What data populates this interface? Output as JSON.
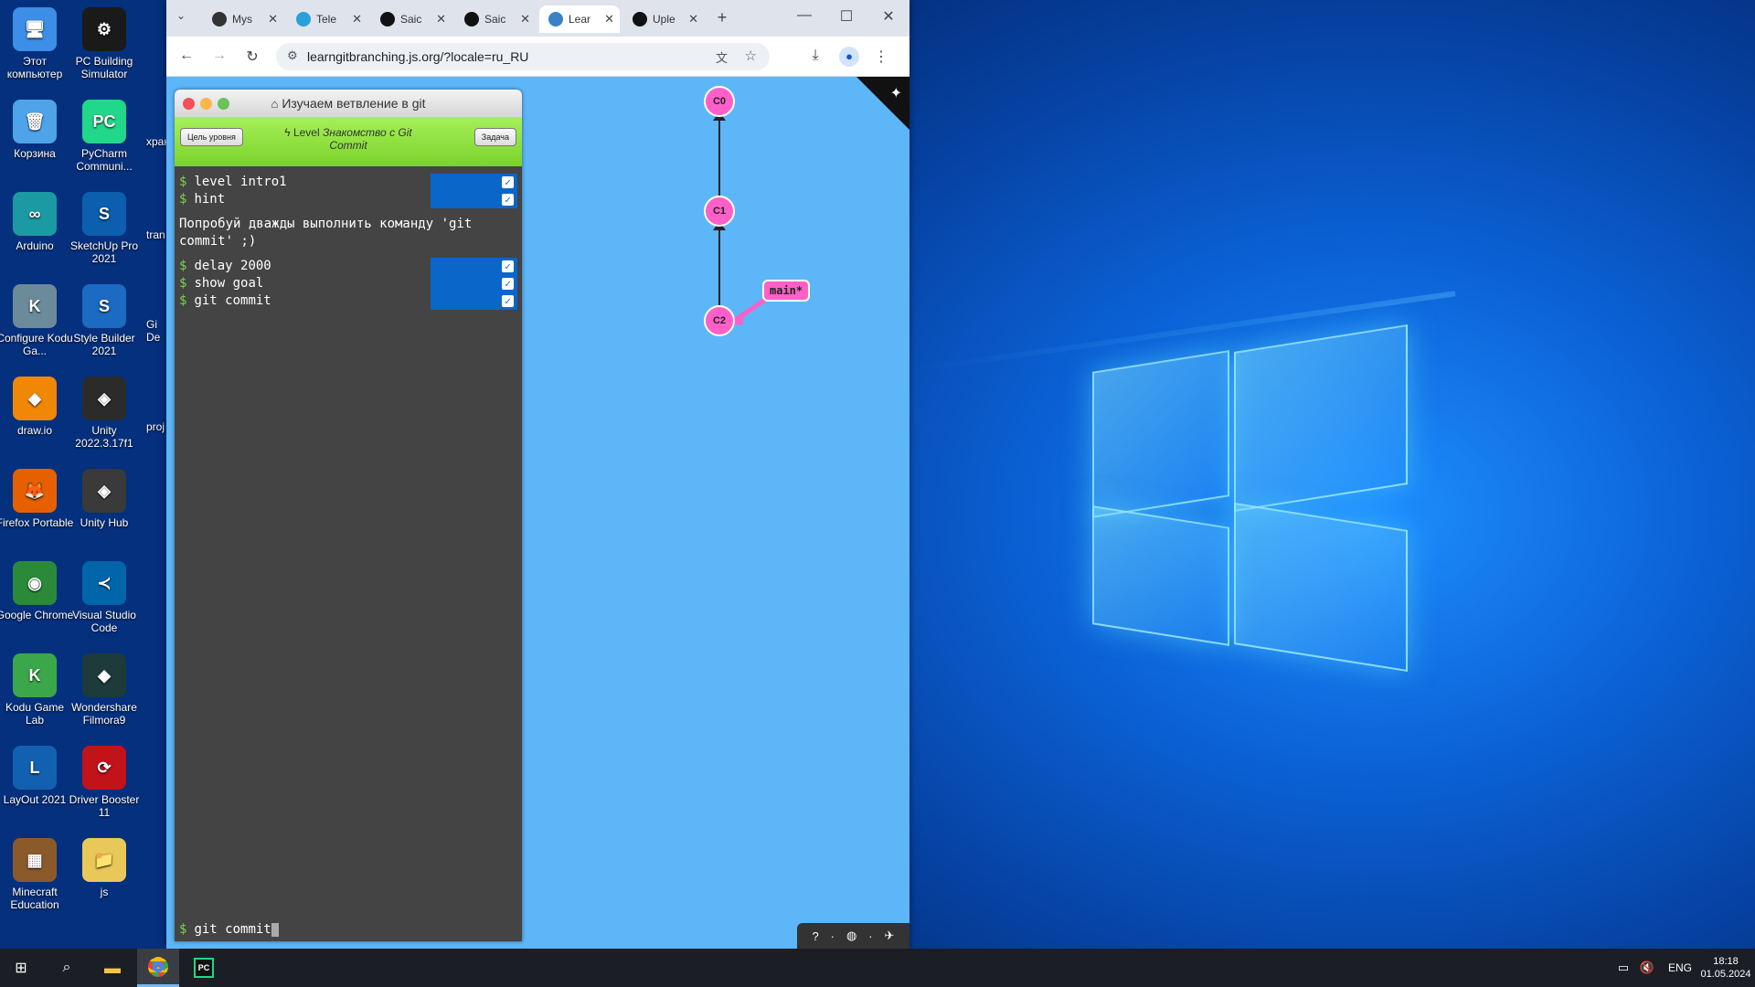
{
  "desktop": {
    "icons": [
      {
        "label": "Этот компьютер",
        "glyph": "🖥",
        "color": "#3c8ee6"
      },
      {
        "label": "PC Building Simulator",
        "glyph": "⚙",
        "color": "#1a1a1a"
      },
      {
        "label": "Корзина",
        "glyph": "🗑",
        "color": "#4fa3e8"
      },
      {
        "label": "PyCharm Communi...",
        "glyph": "PC",
        "color": "#21d789"
      },
      {
        "label": "Arduino",
        "glyph": "∞",
        "color": "#1c9aa4"
      },
      {
        "label": "SketchUp Pro 2021",
        "glyph": "S",
        "color": "#0b5fae"
      },
      {
        "label": "Configure Kodu Ga...",
        "glyph": "K",
        "color": "#6b8a9a"
      },
      {
        "label": "Style Builder 2021",
        "glyph": "S",
        "color": "#1b6bc2"
      },
      {
        "label": "draw.io",
        "glyph": "◆",
        "color": "#f08705"
      },
      {
        "label": "Unity 2022.3.17f1",
        "glyph": "◈",
        "color": "#2b2b2b"
      },
      {
        "label": "Firefox Portable",
        "glyph": "🦊",
        "color": "#e66000"
      },
      {
        "label": "Unity Hub",
        "glyph": "◈",
        "color": "#3a3a3a"
      },
      {
        "label": "Google Chrome",
        "glyph": "◉",
        "color": "#2a8a3a"
      },
      {
        "label": "Visual Studio Code",
        "glyph": "≺",
        "color": "#0065a9"
      },
      {
        "label": "Kodu Game Lab",
        "glyph": "K",
        "color": "#3aa84a"
      },
      {
        "label": "Wondershare Filmora9",
        "glyph": "◆",
        "color": "#1d3b3a"
      },
      {
        "label": "LayOut 2021",
        "glyph": "L",
        "color": "#1261b0"
      },
      {
        "label": "Driver Booster 11",
        "glyph": "⟳",
        "color": "#c2121a"
      },
      {
        "label": "Minecraft Education",
        "glyph": "▦",
        "color": "#8b5a2b"
      },
      {
        "label": "js",
        "glyph": "📁",
        "color": "#e9c85a"
      }
    ],
    "partial_labels": [
      "хран",
      "tran",
      "Gi De",
      "proj"
    ]
  },
  "browser": {
    "tabs": [
      {
        "label": "Mys",
        "icon": "graduation-cap-icon",
        "color": "#333"
      },
      {
        "label": "Tele",
        "icon": "telegram-icon",
        "color": "#2a9fd8"
      },
      {
        "label": "Saic",
        "icon": "github-icon",
        "color": "#111"
      },
      {
        "label": "Saic",
        "icon": "github-icon",
        "color": "#111"
      },
      {
        "label": "Lear",
        "icon": "learngit-icon",
        "color": "#3b82c4"
      },
      {
        "label": "Uple",
        "icon": "github-icon",
        "color": "#111"
      }
    ],
    "new_tab": "+",
    "url": "learngitbranching.js.org/?locale=ru_RU"
  },
  "git": {
    "title": "Изучаем ветвление в git",
    "level_prefix": "Level",
    "level_name": "Знакомство с Git Commit",
    "goal_button": "Цель уровня",
    "task_button": "Задача",
    "history_top": [
      "level intro1",
      "hint"
    ],
    "hint": "Попробуй дважды выполнить команду 'git commit' ;)",
    "history_bottom": [
      "delay 2000",
      "show goal",
      "git commit"
    ],
    "prompt_dollar": "$",
    "input": "git commit"
  },
  "graph": {
    "commits": [
      "C0",
      "C1",
      "C2"
    ],
    "branch": "main*",
    "accent": "#ff5fc8"
  },
  "taskbar": {
    "language": "ENG",
    "time": "18:18",
    "date": "01.05.2024"
  }
}
